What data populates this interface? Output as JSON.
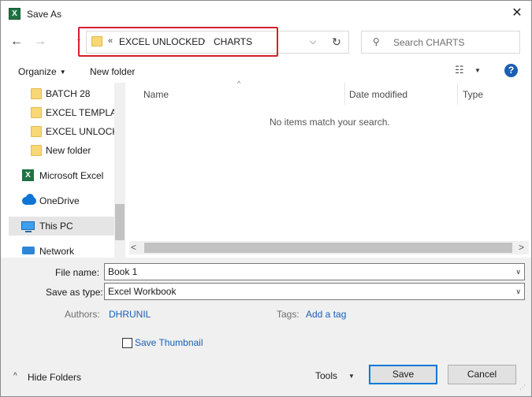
{
  "window": {
    "title": "Save As",
    "icon_letter": "X",
    "close_glyph": "✕"
  },
  "nav": {
    "back_glyph": "←",
    "forward_glyph": "→",
    "up_glyph": "↑",
    "breadcrumb_overflow": "«",
    "breadcrumb": [
      "EXCEL UNLOCKED",
      "CHARTS"
    ],
    "breadcrumb_sep": "›",
    "dropdown_glyph": "⌵",
    "refresh_glyph": "↻",
    "search_glyph": "⚲",
    "search_placeholder": "Search CHARTS"
  },
  "toolbar": {
    "organize_label": "Organize",
    "new_folder_label": "New folder",
    "view_glyph": "☷",
    "help_label": "?"
  },
  "sidebar": {
    "items": [
      {
        "label": "BATCH 28",
        "icon": "folder-icon"
      },
      {
        "label": "EXCEL TEMPLAT",
        "icon": "folder-icon"
      },
      {
        "label": "EXCEL UNLOCKE",
        "icon": "folder-icon"
      },
      {
        "label": "New folder",
        "icon": "folder-icon"
      },
      {
        "label": "Microsoft Excel",
        "icon": "excel-icon"
      },
      {
        "label": "OneDrive",
        "icon": "cloud-icon"
      },
      {
        "label": "This PC",
        "icon": "pc-icon",
        "selected": true
      },
      {
        "label": "Network",
        "icon": "network-icon"
      }
    ]
  },
  "filelist": {
    "columns": [
      "Name",
      "Date modified",
      "Type"
    ],
    "sort_glyph": "^",
    "empty_message": "No items match your search.",
    "scroll_left_glyph": "<",
    "scroll_right_glyph": ">"
  },
  "form": {
    "filename_label": "File name:",
    "filename_value": "Book 1",
    "savetype_label": "Save as type:",
    "savetype_value": "Excel Workbook",
    "authors_label": "Authors:",
    "authors_value": "DHRUNIL",
    "tags_label": "Tags:",
    "tags_value": "Add a tag",
    "thumbnail_label": "Save Thumbnail",
    "caret_glyph": "∨"
  },
  "footer": {
    "hide_folders_label": "Hide Folders",
    "hide_glyph": "^",
    "tools_label": "Tools",
    "save_label": "Save",
    "cancel_label": "Cancel"
  },
  "colors": {
    "accent": "#0078d7",
    "highlight_border": "#d3202f",
    "link": "#1a5fb4",
    "excel_green": "#1f7244",
    "folder_yellow": "#f8d775"
  }
}
